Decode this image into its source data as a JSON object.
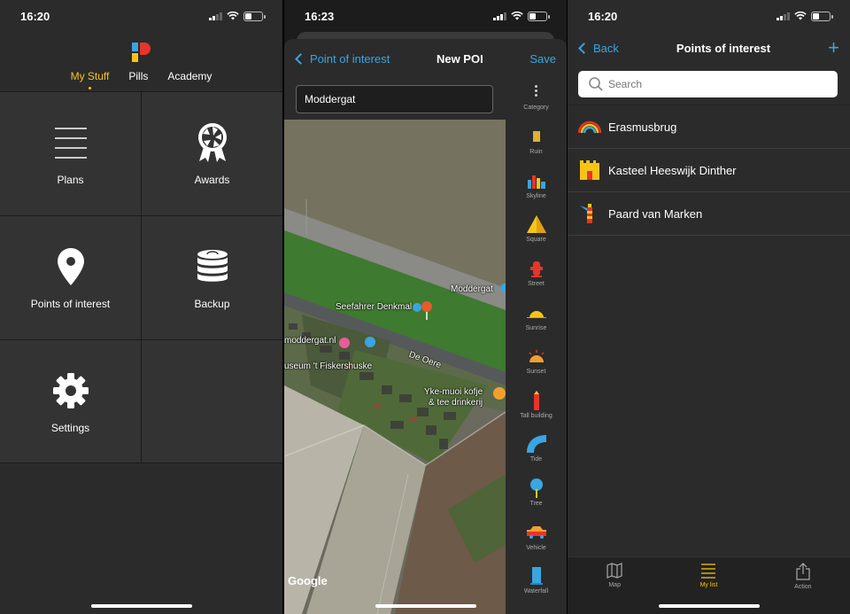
{
  "screen1": {
    "time": "16:20",
    "tabs": [
      {
        "label": "My Stuff"
      },
      {
        "label": "Pills"
      },
      {
        "label": "Academy"
      }
    ],
    "tiles": [
      {
        "label": "Plans",
        "icon": "list-lines-icon"
      },
      {
        "label": "Awards",
        "icon": "aperture-award-icon"
      },
      {
        "label": "Points of interest",
        "icon": "map-pin-icon"
      },
      {
        "label": "Backup",
        "icon": "database-sync-icon"
      },
      {
        "label": "Settings",
        "icon": "gear-icon"
      }
    ],
    "accent": "#f6c417"
  },
  "screen2": {
    "time": "16:23",
    "back_label": "Point of interest",
    "title": "New POI",
    "save_label": "Save",
    "name_value": "Moddergat",
    "category_header": "Category",
    "categories": [
      {
        "label": "Ruin"
      },
      {
        "label": "Skyline"
      },
      {
        "label": "Square"
      },
      {
        "label": "Street"
      },
      {
        "label": "Sunrise"
      },
      {
        "label": "Sunset"
      },
      {
        "label": "Tall building"
      },
      {
        "label": "Tide"
      },
      {
        "label": "Tree"
      },
      {
        "label": "Vehicle"
      },
      {
        "label": "Waterfall"
      }
    ],
    "map_labels": {
      "moddergat": "Moddergat",
      "seefahrer": "Seefahrer Denkmal",
      "moddergat_nl": "moddergat.nl",
      "museum": "useum 't Fiskershuske",
      "de_oere": "De Oere",
      "yke_1": "Yke-muoi kofje",
      "yke_2": "& tee drinkerij"
    },
    "map_attribution": "Google",
    "link_color": "#3aa5e0"
  },
  "screen3": {
    "time": "16:20",
    "back_label": "Back",
    "title": "Points of interest",
    "add_label": "+",
    "search_placeholder": "Search",
    "items": [
      {
        "label": "Erasmusbrug",
        "icon": "rainbow-bridge-icon"
      },
      {
        "label": "Kasteel Heeswijk Dinther",
        "icon": "castle-icon"
      },
      {
        "label": "Paard van Marken",
        "icon": "lighthouse-icon"
      }
    ],
    "tabbar": [
      {
        "label": "Map",
        "icon": "map-icon"
      },
      {
        "label": "My list",
        "icon": "list-icon"
      },
      {
        "label": "Action",
        "icon": "share-icon"
      }
    ]
  }
}
